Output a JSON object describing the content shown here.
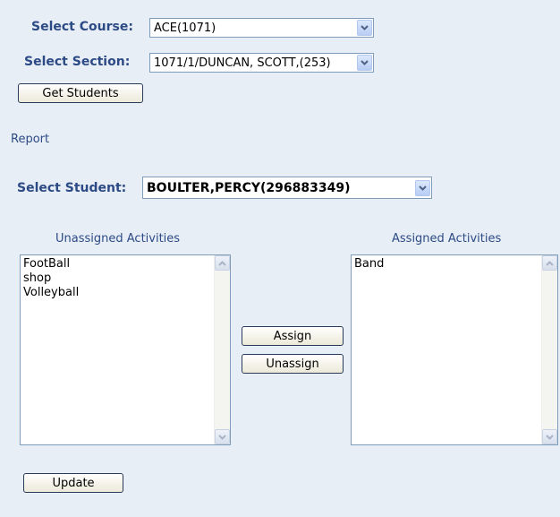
{
  "course": {
    "label": "Select Course:",
    "value": "ACE(1071)"
  },
  "section": {
    "label": "Select Section:",
    "value": "1071/1/DUNCAN, SCOTT,(253)"
  },
  "get_students_button": "Get Students",
  "report_label": "Report",
  "student": {
    "label": "Select Student:",
    "value": "BOULTER,PERCY(296883349)"
  },
  "unassigned": {
    "header": "Unassigned Activities",
    "items": [
      "FootBall",
      "shop",
      "Volleyball"
    ]
  },
  "assigned": {
    "header": "Assigned Activities",
    "items": [
      "Band"
    ]
  },
  "assign_button": "Assign",
  "unassign_button": "Unassign",
  "update_button": "Update",
  "icons": {
    "dropdown": "chevron-down-icon",
    "scroll_up": "scroll-up-arrow-icon",
    "scroll_down": "scroll-down-arrow-icon"
  },
  "colors": {
    "label": "#2c4a85",
    "background": "#e8eef6",
    "border": "#7f9db9"
  }
}
